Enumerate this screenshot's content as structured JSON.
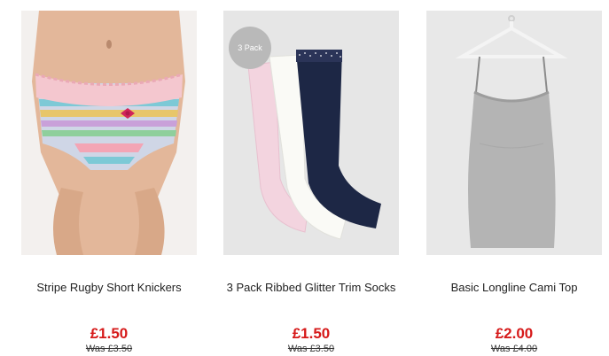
{
  "products": [
    {
      "title": "Stripe Rugby Short Knickers",
      "price": "£1.50",
      "was": "Was £3.50",
      "image_icon": "knickers-image",
      "badge": ""
    },
    {
      "title": "3 Pack Ribbed Glitter Trim Socks",
      "price": "£1.50",
      "was": "Was £3.50",
      "image_icon": "socks-image",
      "badge": "3 Pack"
    },
    {
      "title": "Basic Longline Cami Top",
      "price": "£2.00",
      "was": "Was £4.00",
      "image_icon": "cami-top-image",
      "badge": ""
    }
  ],
  "colors": {
    "price": "#d61a1a",
    "badge_bg": "#b9b9b9",
    "image_bg": "#eeeeee"
  }
}
